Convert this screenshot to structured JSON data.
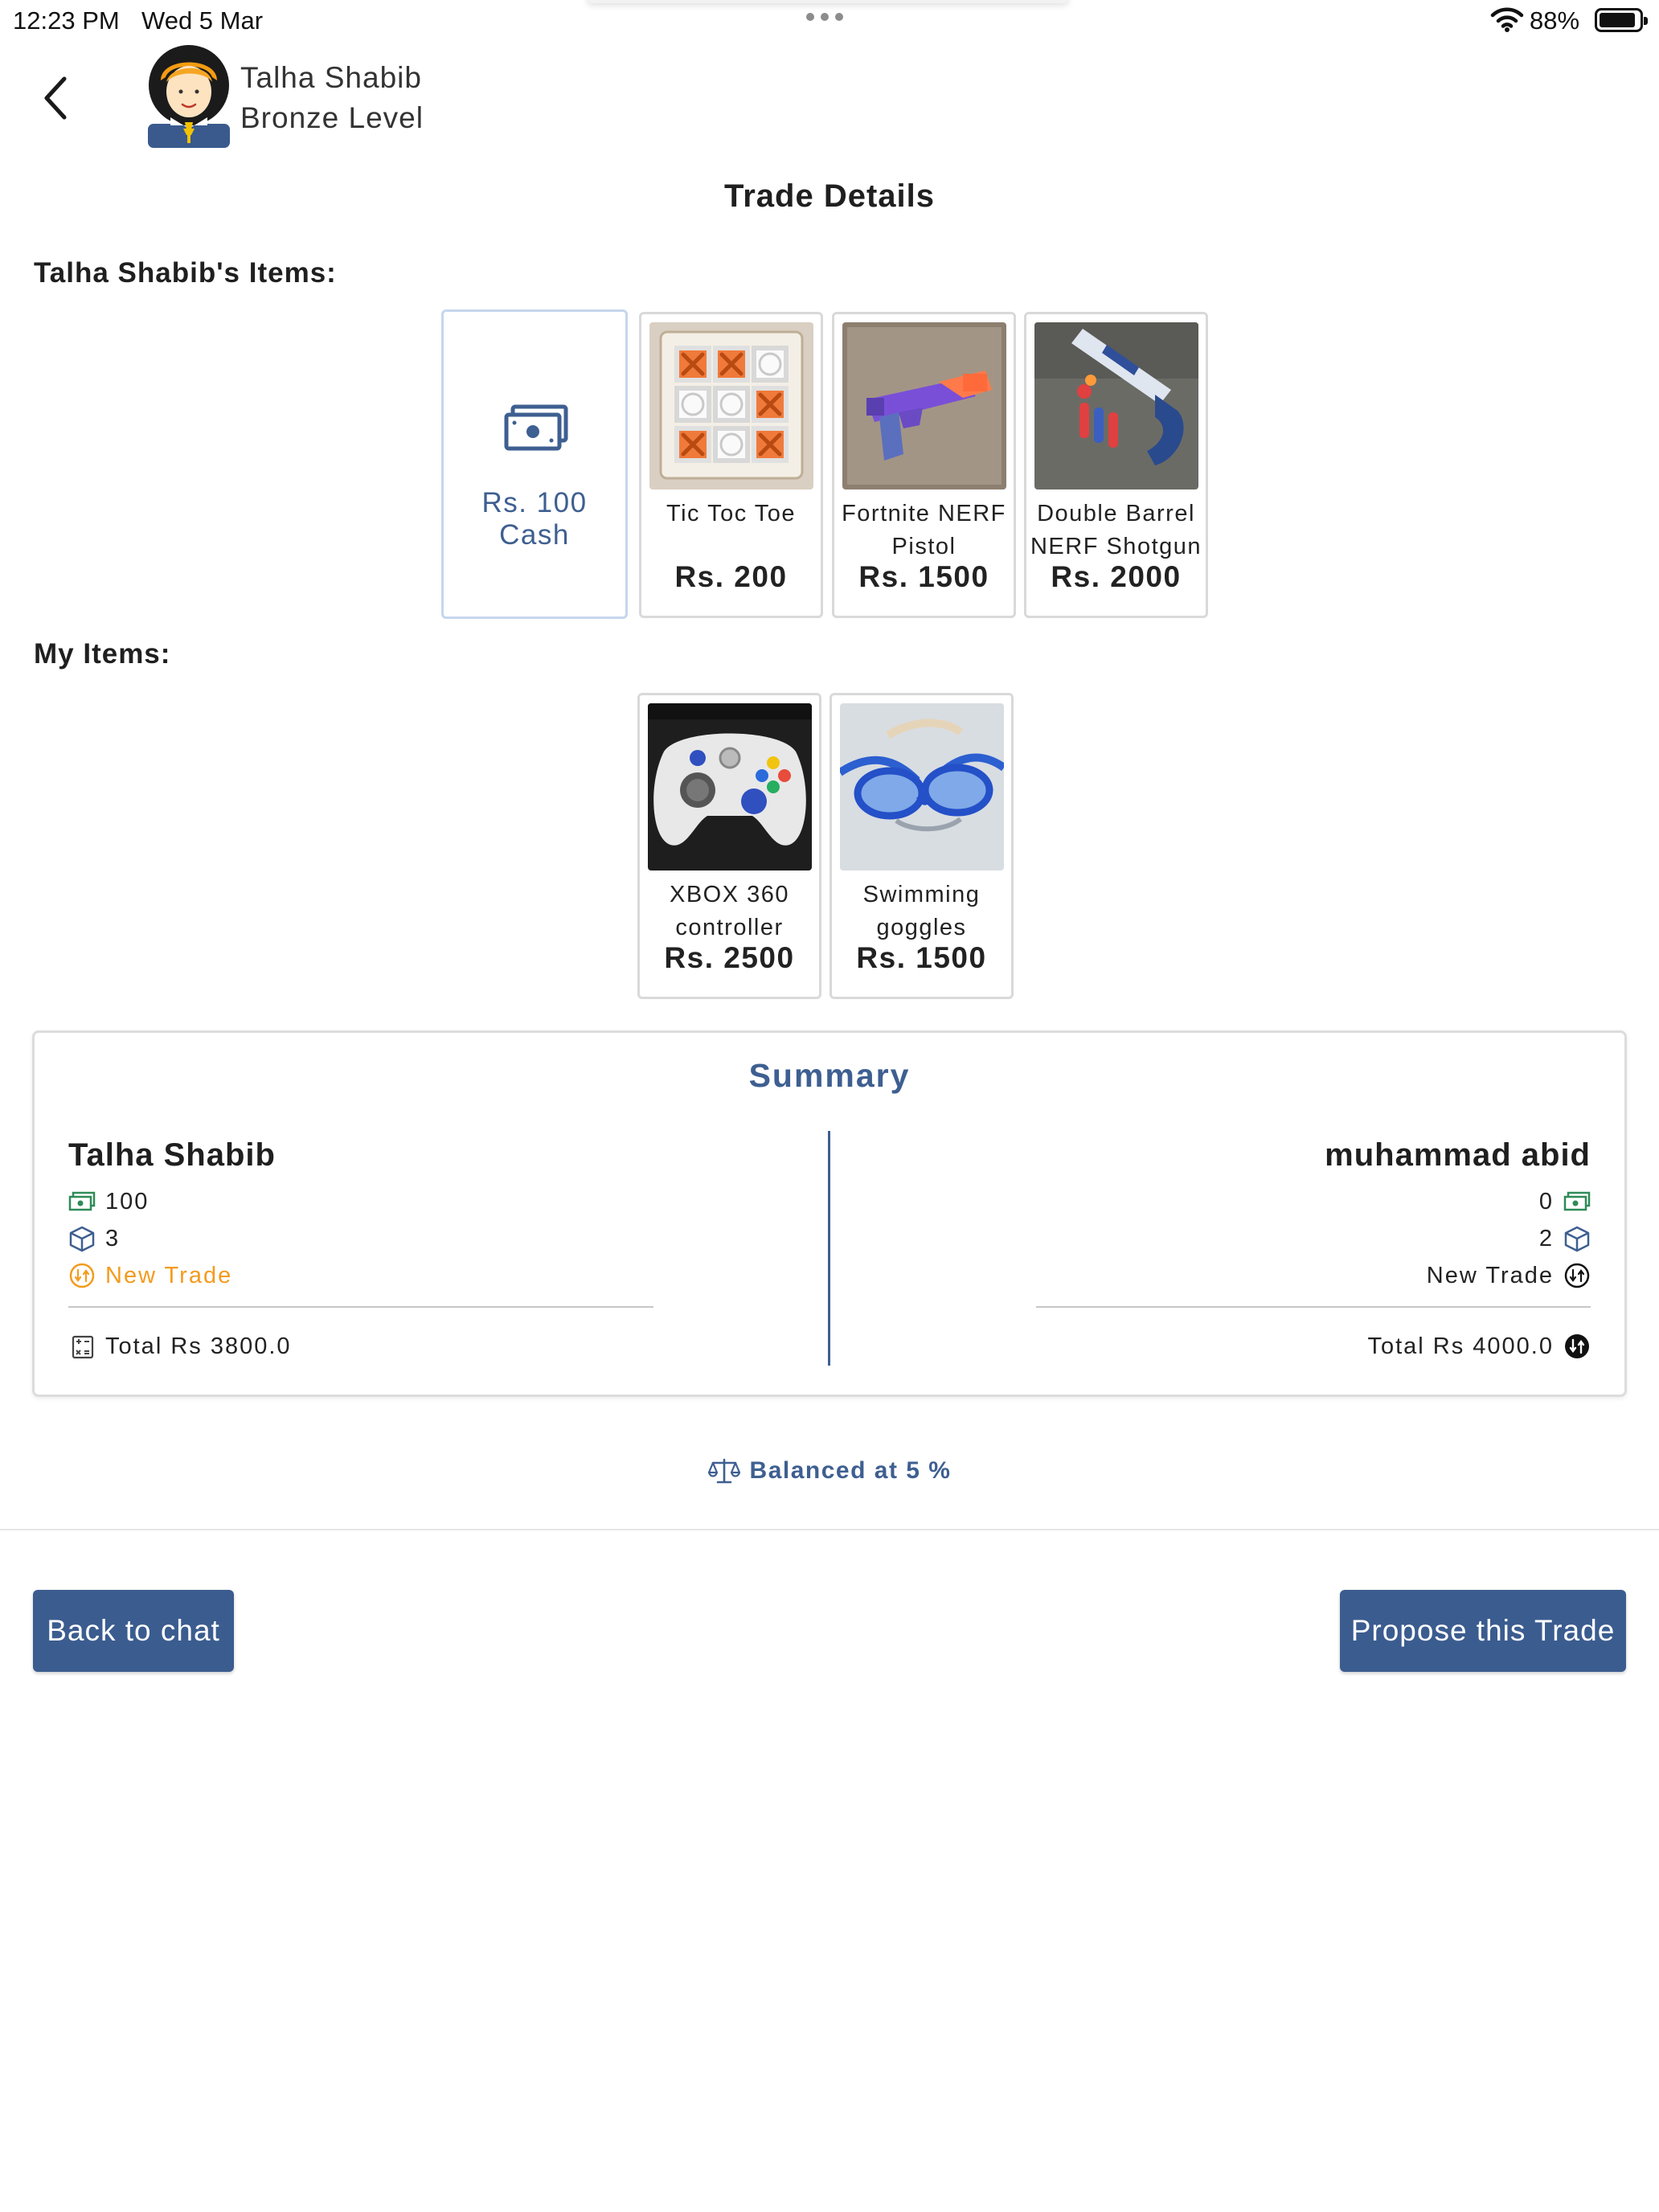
{
  "status_bar": {
    "time": "12:23 PM",
    "date": "Wed 5 Mar",
    "battery": "88%",
    "battery_level": 0.88,
    "icons": [
      "wifi-icon",
      "battery-icon"
    ]
  },
  "header": {
    "user_name": "Talha Shabib",
    "user_level": "Bronze Level",
    "title": "Trade Details"
  },
  "their_items": {
    "label": "Talha Shabib's Items:",
    "cash": {
      "label": "Rs. 100 Cash"
    },
    "items": [
      {
        "name_line1": "Tic Toc Toe",
        "name_line2": "",
        "price": "Rs. 200"
      },
      {
        "name_line1": "Fortnite NERF",
        "name_line2": "Pistol",
        "price": "Rs. 1500"
      },
      {
        "name_line1": "Double Barrel",
        "name_line2": "NERF Shotgun",
        "price": "Rs. 2000"
      }
    ]
  },
  "my_items": {
    "label": "My Items:",
    "items": [
      {
        "name_line1": "XBOX 360",
        "name_line2": "controller",
        "price": "Rs. 2500"
      },
      {
        "name_line1": "Swimming",
        "name_line2": "goggles",
        "price": "Rs. 1500"
      }
    ]
  },
  "summary": {
    "title": "Summary",
    "left": {
      "name": "Talha Shabib",
      "cash": "100",
      "items": "3",
      "status": "New Trade",
      "total": "Total Rs 3800.0"
    },
    "right": {
      "name": "muhammad abid",
      "cash": "0",
      "items": "2",
      "status": "New Trade",
      "total": "Total Rs 4000.0"
    }
  },
  "balance": {
    "text": "Balanced at 5 %"
  },
  "buttons": {
    "back": "Back to chat",
    "propose": "Propose this Trade"
  },
  "colors": {
    "accent": "#3e5f91",
    "button": "#3b5c8f",
    "orange": "#f39b1e",
    "cash_green": "#2e8b57"
  }
}
